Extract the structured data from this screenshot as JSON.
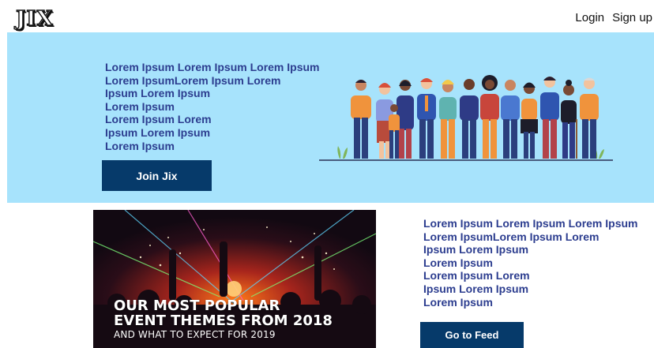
{
  "header": {
    "logo": "JIX",
    "login": "Login",
    "signup": "Sign up"
  },
  "hero": {
    "lines": [
      "Lorem Ipsum Lorem Ipsum Lorem Ipsum",
      "Lorem IpsumLorem Ipsum Lorem",
      "Ipsum Lorem Ipsum",
      "Lorem Ipsum",
      "Lorem Ipsum Lorem",
      "Ipsum Lorem Ipsum",
      "Lorem Ipsum"
    ],
    "button": "Join Jix"
  },
  "event_banner": {
    "title_line1": "OUR MOST POPULAR",
    "title_line2": "EVENT THEMES FROM 2018",
    "subtitle": "AND WHAT TO EXPECT FOR 2019"
  },
  "feed": {
    "lines": [
      "Lorem Ipsum Lorem Ipsum Lorem Ipsum",
      "Lorem IpsumLorem Ipsum Lorem",
      "Ipsum Lorem Ipsum",
      "Lorem Ipsum",
      "Lorem Ipsum Lorem",
      "Ipsum Lorem Ipsum",
      "Lorem Ipsum"
    ],
    "button": "Go to Feed"
  },
  "colors": {
    "hero_bg": "#a7e3fc",
    "button_bg": "#063a6a",
    "text_accent": "#2c3d8f"
  }
}
